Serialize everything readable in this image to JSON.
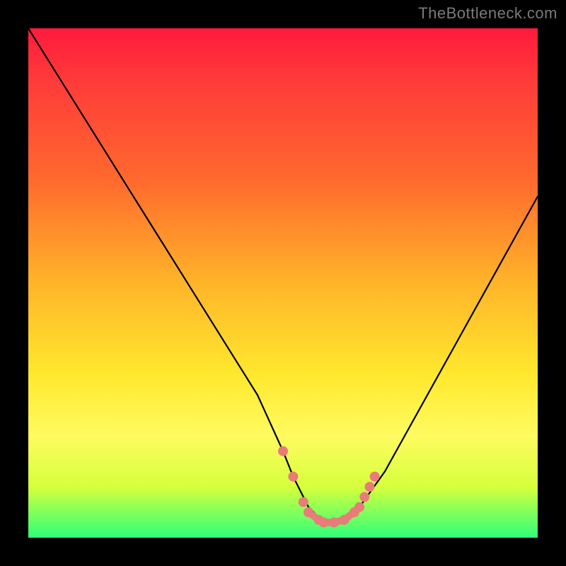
{
  "watermark": "TheBottleneck.com",
  "colors": {
    "background": "#000000",
    "gradient_top": "#ff1a3c",
    "gradient_mid1": "#ff6a2e",
    "gradient_mid2": "#ffe82e",
    "gradient_bottom": "#2eff7a",
    "curve": "#000000",
    "markers": "#e97b78"
  },
  "chart_data": {
    "type": "line",
    "title": "",
    "xlabel": "",
    "ylabel": "",
    "xlim": [
      0,
      100
    ],
    "ylim": [
      0,
      100
    ],
    "mapping_note": "single bottleneck curve; minimum near x≈58, steep left branch, shallower right branch; y expressed as percent of plot height from bottom",
    "x": [
      0,
      5,
      10,
      15,
      20,
      25,
      30,
      35,
      40,
      45,
      50,
      52,
      55,
      58,
      60,
      63,
      65,
      70,
      75,
      80,
      85,
      90,
      95,
      100
    ],
    "y": [
      100,
      92,
      84,
      76,
      68,
      60,
      52,
      44,
      36,
      28,
      17,
      12,
      6,
      3,
      3,
      4,
      6,
      13,
      22,
      31,
      40,
      49,
      58,
      67
    ],
    "markers": {
      "note": "salmon marker dots around curve minimum",
      "points": [
        {
          "x": 50,
          "y": 17
        },
        {
          "x": 52,
          "y": 12
        },
        {
          "x": 54,
          "y": 7
        },
        {
          "x": 55,
          "y": 5
        },
        {
          "x": 57,
          "y": 3.5
        },
        {
          "x": 58,
          "y": 3
        },
        {
          "x": 60,
          "y": 3
        },
        {
          "x": 62,
          "y": 3.5
        },
        {
          "x": 64,
          "y": 5
        },
        {
          "x": 65,
          "y": 6
        },
        {
          "x": 66,
          "y": 8
        },
        {
          "x": 67,
          "y": 10
        },
        {
          "x": 68,
          "y": 12
        }
      ]
    }
  }
}
